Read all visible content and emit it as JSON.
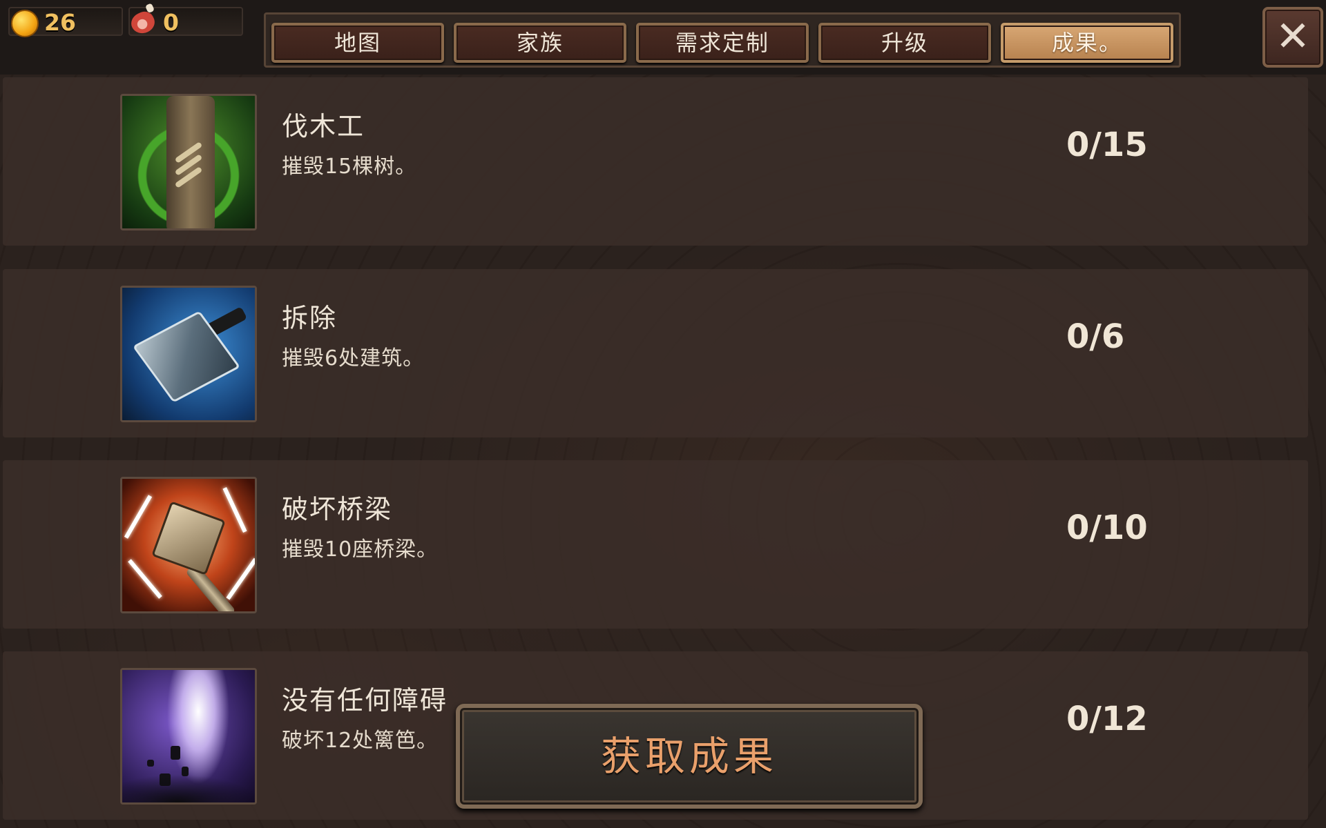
{
  "resources": {
    "coin": {
      "icon": "gold-coin-icon",
      "value": "26"
    },
    "meat": {
      "icon": "meat-icon",
      "value": "0"
    }
  },
  "tabs": [
    {
      "label": "地图",
      "active": false
    },
    {
      "label": "家族",
      "active": false
    },
    {
      "label": "需求定制",
      "active": false
    },
    {
      "label": "升级",
      "active": false
    },
    {
      "label": "成果。",
      "active": true
    }
  ],
  "close": {
    "icon": "close-icon",
    "glyph": "✕"
  },
  "achievements": [
    {
      "icon": "tree-chop-icon",
      "title": "伐木工",
      "desc": "摧毁15棵树。",
      "progress": "0/15",
      "current": 0,
      "target": 15
    },
    {
      "icon": "hammer-icon",
      "title": "拆除",
      "desc": "摧毁6处建筑。",
      "progress": "0/6",
      "current": 0,
      "target": 6
    },
    {
      "icon": "lightning-mace-icon",
      "title": "破坏桥梁",
      "desc": "摧毁10座桥梁。",
      "progress": "0/10",
      "current": 0,
      "target": 10
    },
    {
      "icon": "purple-blast-icon",
      "title": "没有任何障碍",
      "desc": "破坏12处篱笆。",
      "progress": "0/12",
      "current": 0,
      "target": 12
    }
  ],
  "claim_button": {
    "label": "获取成果"
  },
  "colors": {
    "active_tab": "#c8965f",
    "progress_text": "#f0e6d6",
    "claim_text": "#e9a06b",
    "coin_text": "#f0c060"
  }
}
